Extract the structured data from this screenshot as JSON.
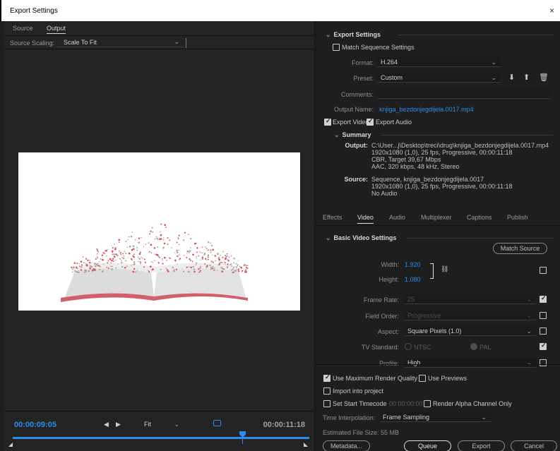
{
  "window": {
    "title": "Export Settings",
    "close": "×"
  },
  "left": {
    "tabs": [
      "Source",
      "Output"
    ],
    "scaling_label": "Source Scaling:",
    "scaling_value": "Scale To Fit",
    "playbar": {
      "current_tc": "00:00:09:05",
      "end_tc": "00:00:11:18",
      "zoom": "Fit",
      "progress": 0.77
    }
  },
  "export": {
    "header": "Export Settings",
    "match_sequence": "Match Sequence Settings",
    "format_label": "Format:",
    "format_value": "H.264",
    "preset_label": "Preset:",
    "preset_value": "Custom",
    "comments_label": "Comments:",
    "output_name_label": "Output Name:",
    "output_name_value": "knjiga_bezdonjegdijela.0017.mp4",
    "export_video": "Export Video",
    "export_audio": "Export Audio"
  },
  "summary": {
    "header": "Summary",
    "output_label": "Output:",
    "output_lines": [
      "C:\\User...j\\Desktop\\treci\\drug\\knjiga_bezdonjegdijela.0017.mp4",
      "1920x1080 (1,0), 25 fps, Progressive, 00:00:11:18",
      "CBR, Target 39,67 Mbps",
      "AAC, 320 kbps, 48 kHz, Stereo"
    ],
    "source_label": "Source:",
    "source_lines": [
      "Sequence, knjiga_bezdonjegdijela.0017",
      "1920x1080 (1,0), 25 fps, Progressive, 00:00:11:18",
      "No Audio"
    ]
  },
  "tabs": [
    "Effects",
    "Video",
    "Audio",
    "Multiplexer",
    "Captions",
    "Publish"
  ],
  "video": {
    "header": "Basic Video Settings",
    "match_source": "Match Source",
    "width_label": "Width:",
    "width_value": "1.920",
    "height_label": "Height:",
    "height_value": "1.080",
    "frame_rate_label": "Frame Rate:",
    "frame_rate_value": "25",
    "field_order_label": "Field Order:",
    "field_order_value": "Progressive",
    "aspect_label": "Aspect:",
    "aspect_value": "Square Pixels (1.0)",
    "tv_standard_label": "TV Standard:",
    "tv_ntsc": "NTSC",
    "tv_pal": "PAL",
    "profile_label": "Profile:",
    "profile_value": "High"
  },
  "bottom": {
    "max_render": "Use Maximum Render Quality",
    "use_previews": "Use Previews",
    "import_project": "Import into project",
    "set_start_tc": "Set Start Timecode",
    "start_tc_value": "00:00:00:00",
    "render_alpha": "Render Alpha Channel Only",
    "time_interp_label": "Time Interpolation:",
    "time_interp_value": "Frame Sampling",
    "file_size": "Estimated File Size:  55 MB",
    "metadata": "Metadata...",
    "queue": "Queue",
    "export": "Export",
    "cancel": "Cancel"
  }
}
